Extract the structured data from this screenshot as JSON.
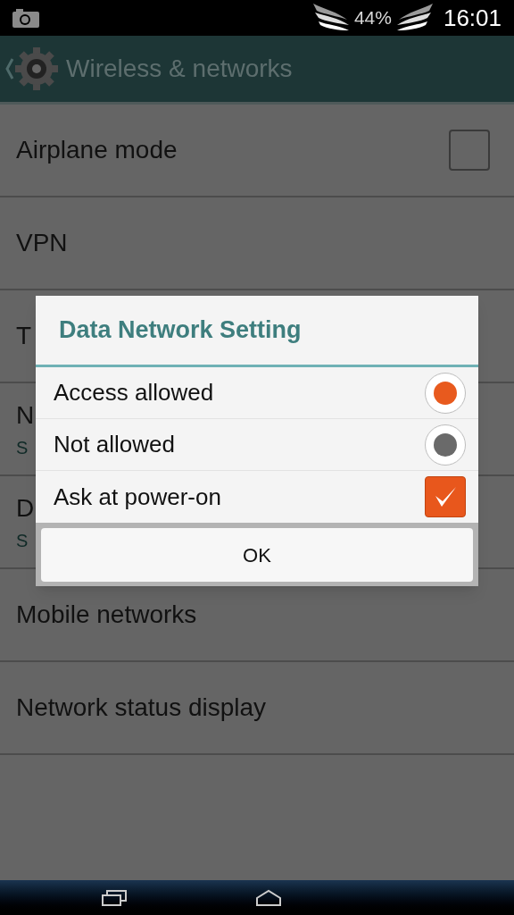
{
  "status_bar": {
    "battery": "44%",
    "time": "16:01"
  },
  "action_bar": {
    "title": "Wireless & networks"
  },
  "settings": [
    {
      "title": "Airplane mode",
      "kind": "checkbox",
      "checked": false
    },
    {
      "title": "VPN",
      "kind": "plain"
    },
    {
      "title": "T",
      "kind": "plain"
    },
    {
      "title": "N",
      "summary": "S",
      "kind": "plain"
    },
    {
      "title": "D",
      "summary": "S",
      "kind": "plain"
    },
    {
      "title": "Mobile networks",
      "kind": "plain"
    },
    {
      "title": "Network status display",
      "kind": "plain"
    }
  ],
  "dialog": {
    "title": "Data Network Setting",
    "options": [
      {
        "label": "Access allowed",
        "kind": "radio",
        "selected": true
      },
      {
        "label": "Not allowed",
        "kind": "radio",
        "selected": false
      },
      {
        "label": "Ask at power-on",
        "kind": "checkbox",
        "checked": true
      }
    ],
    "button": "OK"
  }
}
